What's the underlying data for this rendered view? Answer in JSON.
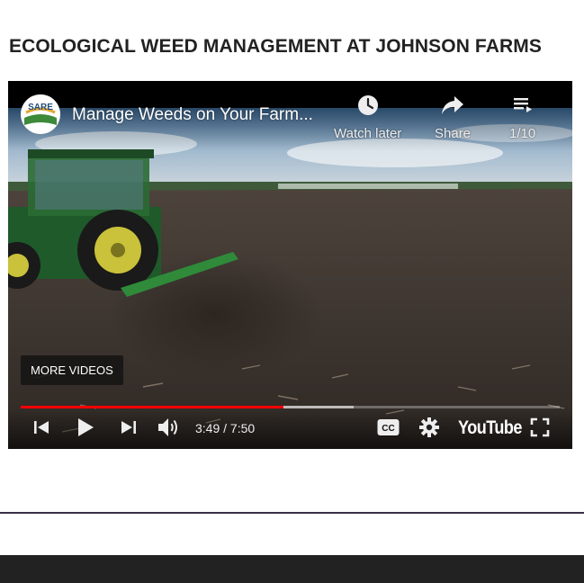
{
  "page": {
    "heading": "ECOLOGICAL WEED MANAGEMENT AT JOHNSON FARMS"
  },
  "video": {
    "channel_logo_text": "SARE",
    "title": "Manage Weeds on Your Farm...",
    "watch_later_label": "Watch later",
    "share_label": "Share",
    "playlist_position": "1/10",
    "more_videos_label": "MORE VIDEOS",
    "current_time": "3:49",
    "duration": "7:50",
    "time_display": "3:49 / 7:50",
    "progress_played_fraction": 0.487,
    "progress_buffered_fraction": 0.617,
    "youtube_label": "YouTube"
  },
  "icons": [
    "sare-logo",
    "clock-icon",
    "share-arrow-icon",
    "playlist-icon",
    "previous-icon",
    "play-icon",
    "next-icon",
    "volume-icon",
    "closed-captions-icon",
    "settings-gear-icon",
    "fullscreen-icon"
  ],
  "colors": {
    "progress_played": "#ff0000",
    "heading_text": "#222222",
    "divider": "#3a2f45",
    "footer": "#222222"
  }
}
